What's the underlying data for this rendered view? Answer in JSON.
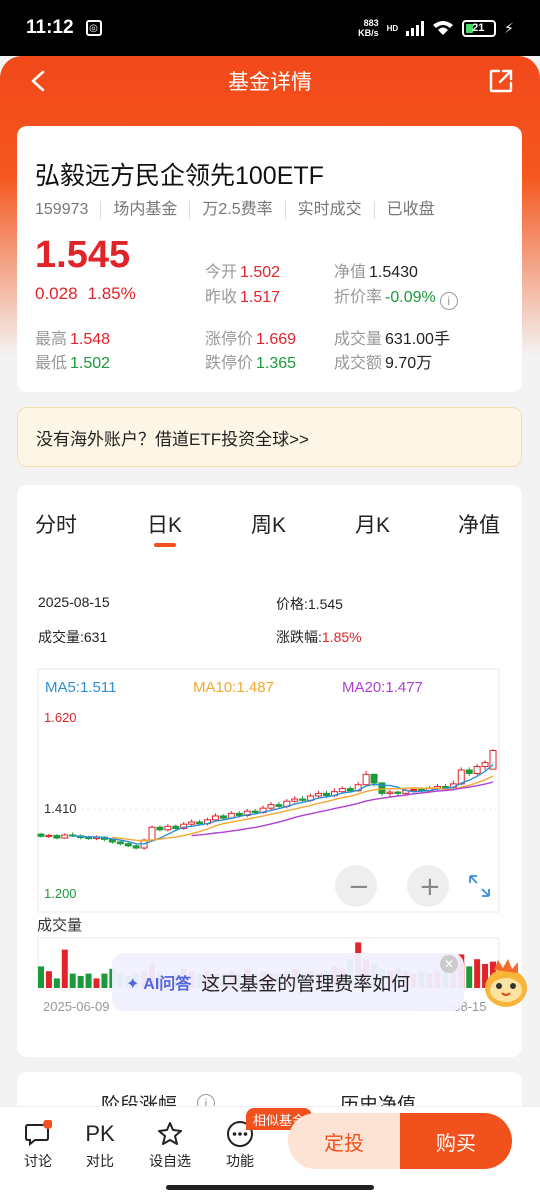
{
  "status_bar": {
    "time": "11:12",
    "net_speed_top": "883",
    "net_speed_bottom": "KB/s",
    "hd": "HD",
    "battery": "21"
  },
  "header": {
    "title": "基金详情"
  },
  "fund": {
    "name": "弘毅远方民企领先100ETF",
    "tags": [
      "159973",
      "场内基金",
      "万2.5费率",
      "实时成交",
      "已收盘"
    ],
    "price": "1.545",
    "change": "0.028",
    "change_pct": "1.85%",
    "open_label": "今开",
    "open": "1.502",
    "prev_close_label": "昨收",
    "prev_close": "1.517",
    "nav_label": "净值",
    "nav": "1.5430",
    "discount_label": "折价率",
    "discount": "-0.09%",
    "high_label": "最高",
    "high": "1.548",
    "low_label": "最低",
    "low": "1.502",
    "limit_up_label": "涨停价",
    "limit_up": "1.669",
    "limit_down_label": "跌停价",
    "limit_down": "1.365",
    "volume_label": "成交量",
    "volume": "631.00手",
    "amount_label": "成交额",
    "amount": "9.70万"
  },
  "banner": {
    "text": "没有海外账户？借道ETF投资全球>>"
  },
  "chart_tabs": [
    "分时",
    "日K",
    "周K",
    "月K",
    "净值"
  ],
  "chart_tab_active": "日K",
  "kline_detail": {
    "date": "2025-08-15",
    "price_label": "价格:",
    "price": "1.545",
    "volume_label": "成交量:",
    "volume": "631",
    "change_label": "涨跌幅:",
    "change": "1.85%"
  },
  "chart_data": {
    "type": "candlestick",
    "ma": [
      {
        "name": "MA5",
        "value": "1.511",
        "color": "#2b8fd6"
      },
      {
        "name": "MA10",
        "value": "1.487",
        "color": "#f0a830"
      },
      {
        "name": "MA20",
        "value": "1.477",
        "color": "#b040d0"
      }
    ],
    "y_ticks": [
      "1.620",
      "1.410",
      "1.200"
    ],
    "ylim": [
      1.2,
      1.62
    ],
    "x_start": "2025-06-09",
    "x_end": "2025-08-15",
    "volume_label": "成交量",
    "candles": [
      [
        1.352,
        1.347,
        1.355,
        1.344
      ],
      [
        1.347,
        1.349,
        1.353,
        1.343
      ],
      [
        1.349,
        1.343,
        1.352,
        1.34
      ],
      [
        1.343,
        1.35,
        1.354,
        1.341
      ],
      [
        1.35,
        1.348,
        1.356,
        1.345
      ],
      [
        1.348,
        1.344,
        1.351,
        1.34
      ],
      [
        1.344,
        1.342,
        1.348,
        1.339
      ],
      [
        1.342,
        1.345,
        1.349,
        1.338
      ],
      [
        1.345,
        1.34,
        1.347,
        1.336
      ],
      [
        1.34,
        1.334,
        1.342,
        1.33
      ],
      [
        1.334,
        1.33,
        1.337,
        1.326
      ],
      [
        1.33,
        1.325,
        1.333,
        1.322
      ],
      [
        1.325,
        1.32,
        1.328,
        1.317
      ],
      [
        1.32,
        1.338,
        1.342,
        1.316
      ],
      [
        1.338,
        1.368,
        1.372,
        1.336
      ],
      [
        1.368,
        1.362,
        1.372,
        1.358
      ],
      [
        1.362,
        1.37,
        1.375,
        1.358
      ],
      [
        1.37,
        1.365,
        1.374,
        1.36
      ],
      [
        1.365,
        1.375,
        1.38,
        1.362
      ],
      [
        1.375,
        1.38,
        1.386,
        1.37
      ],
      [
        1.38,
        1.376,
        1.385,
        1.372
      ],
      [
        1.376,
        1.385,
        1.39,
        1.372
      ],
      [
        1.385,
        1.394,
        1.4,
        1.381
      ],
      [
        1.394,
        1.389,
        1.398,
        1.384
      ],
      [
        1.389,
        1.4,
        1.405,
        1.386
      ],
      [
        1.4,
        1.395,
        1.405,
        1.39
      ],
      [
        1.395,
        1.405,
        1.41,
        1.391
      ],
      [
        1.405,
        1.402,
        1.41,
        1.398
      ],
      [
        1.402,
        1.412,
        1.418,
        1.399
      ],
      [
        1.412,
        1.42,
        1.426,
        1.408
      ],
      [
        1.42,
        1.416,
        1.426,
        1.41
      ],
      [
        1.416,
        1.428,
        1.433,
        1.412
      ],
      [
        1.428,
        1.433,
        1.44,
        1.425
      ],
      [
        1.433,
        1.43,
        1.44,
        1.425
      ],
      [
        1.43,
        1.44,
        1.446,
        1.426
      ],
      [
        1.44,
        1.446,
        1.452,
        1.436
      ],
      [
        1.446,
        1.441,
        1.452,
        1.436
      ],
      [
        1.441,
        1.45,
        1.458,
        1.438
      ],
      [
        1.45,
        1.457,
        1.462,
        1.445
      ],
      [
        1.457,
        1.452,
        1.462,
        1.448
      ],
      [
        1.452,
        1.466,
        1.472,
        1.45
      ],
      [
        1.466,
        1.49,
        1.498,
        1.462
      ],
      [
        1.49,
        1.47,
        1.492,
        1.462
      ],
      [
        1.47,
        1.446,
        1.472,
        1.44
      ],
      [
        1.446,
        1.449,
        1.454,
        1.438
      ],
      [
        1.449,
        1.446,
        1.452,
        1.44
      ],
      [
        1.446,
        1.453,
        1.458,
        1.442
      ],
      [
        1.453,
        1.455,
        1.46,
        1.448
      ],
      [
        1.455,
        1.452,
        1.46,
        1.447
      ],
      [
        1.452,
        1.458,
        1.463,
        1.448
      ],
      [
        1.458,
        1.462,
        1.468,
        1.452
      ],
      [
        1.462,
        1.46,
        1.468,
        1.455
      ],
      [
        1.46,
        1.468,
        1.476,
        1.456
      ],
      [
        1.468,
        1.5,
        1.506,
        1.465
      ],
      [
        1.5,
        1.492,
        1.506,
        1.486
      ],
      [
        1.492,
        1.508,
        1.514,
        1.488
      ],
      [
        1.508,
        1.517,
        1.522,
        1.5
      ],
      [
        1.502,
        1.545,
        1.548,
        1.502
      ]
    ],
    "volumes": [
      0.45,
      0.35,
      0.2,
      0.8,
      0.3,
      0.25,
      0.3,
      0.2,
      0.3,
      0.4,
      0.3,
      0.25,
      0.3,
      0.35,
      0.5,
      0.3,
      0.25,
      0.3,
      0.4,
      0.35,
      0.3,
      0.35,
      0.3,
      0.3,
      0.35,
      0.3,
      0.4,
      0.3,
      0.35,
      0.3,
      0.3,
      0.35,
      0.4,
      0.3,
      0.35,
      0.3,
      0.35,
      0.45,
      0.4,
      0.6,
      0.95,
      0.6,
      0.5,
      0.4,
      0.35,
      0.4,
      0.35,
      0.3,
      0.35,
      0.3,
      0.35,
      0.4,
      0.5,
      0.7,
      0.45,
      0.6,
      0.5,
      0.55
    ]
  },
  "ai": {
    "tag": "AI问答",
    "question": "这只基金的管理费率如何"
  },
  "next_section": {
    "stage_label": "阶段涨幅",
    "history_label": "历史净值"
  },
  "bottom_nav": {
    "items": [
      {
        "label": "讨论",
        "icon": "chat-icon"
      },
      {
        "label": "对比",
        "icon": "pk-icon",
        "glyph": "PK"
      },
      {
        "label": "设自选",
        "icon": "star-icon"
      },
      {
        "label": "功能",
        "icon": "more-icon"
      }
    ],
    "similar_badge": "相似基金",
    "ding": "定投",
    "buy": "购买"
  }
}
